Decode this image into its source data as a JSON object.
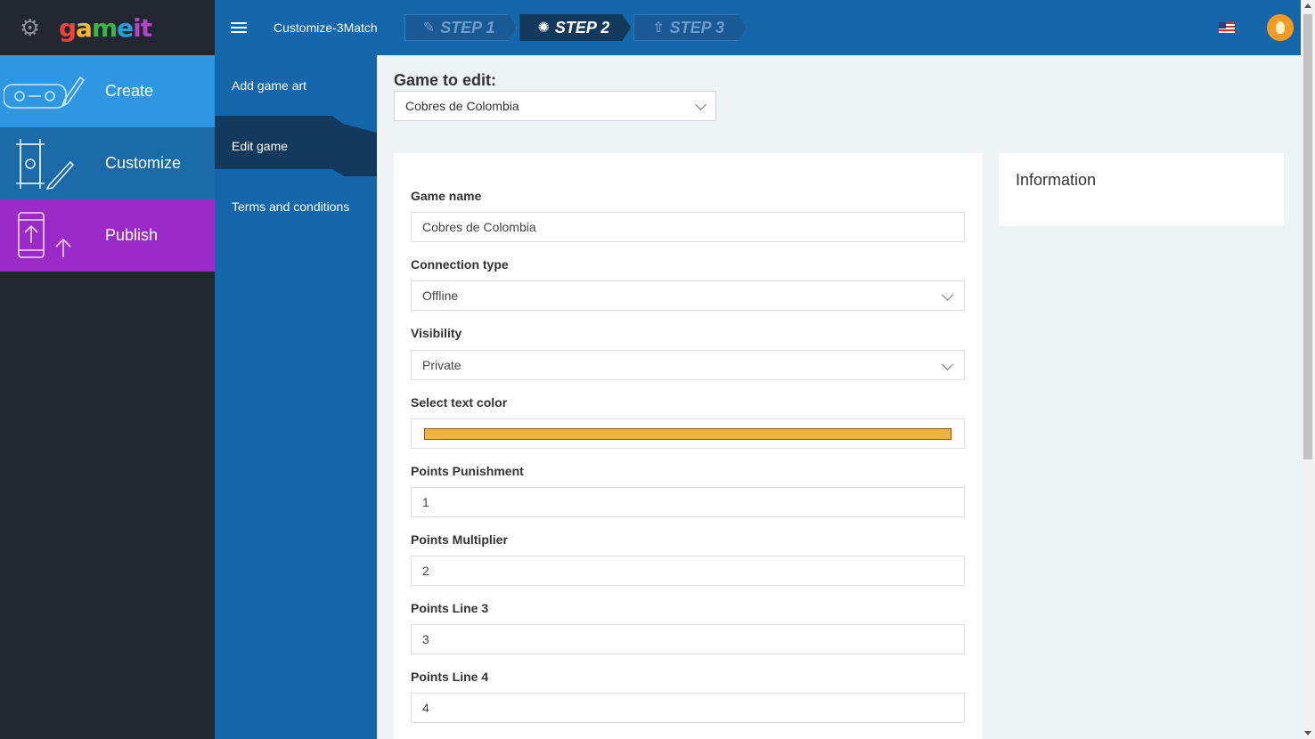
{
  "brand": {
    "logo_parts": [
      "g",
      "a",
      "m",
      "e",
      "it"
    ]
  },
  "nav": [
    {
      "label": "Create",
      "icon": "gamepad-pencil-icon"
    },
    {
      "label": "Customize",
      "icon": "phone-brush-icon"
    },
    {
      "label": "Publish",
      "icon": "phone-upload-icon"
    }
  ],
  "topbar": {
    "app_title": "Customize-3Match",
    "steps": [
      "STEP 1",
      "STEP 2",
      "STEP 3"
    ],
    "active_step": "STEP 2"
  },
  "submenu": [
    "Add game art",
    "Edit game",
    "Terms and conditions"
  ],
  "content": {
    "game_to_edit_label": "Game to edit:",
    "game_to_edit_value": "Cobres de Colombia",
    "fields": {
      "game_name_label": "Game name",
      "game_name_value": "Cobres de Colombia",
      "connection_type_label": "Connection type",
      "connection_type_value": "Offline",
      "visibility_label": "Visibility",
      "visibility_value": "Private",
      "text_color_label": "Select text color",
      "text_color_value": "#f0b341",
      "points_punishment_label": "Points Punishment",
      "points_punishment_value": "1",
      "points_multiplier_label": "Points Multiplier",
      "points_multiplier_value": "2",
      "points_line3_label": "Points Line 3",
      "points_line3_value": "3",
      "points_line4_label": "Points Line 4",
      "points_line4_value": "4"
    },
    "info_title": "Information"
  },
  "colors": {
    "sidebar": "#222630",
    "create": "#2d97e2",
    "customize": "#1b6aa8",
    "publish": "#9a2bc9",
    "topbar": "#1467ab",
    "active_dark": "#13395c"
  }
}
